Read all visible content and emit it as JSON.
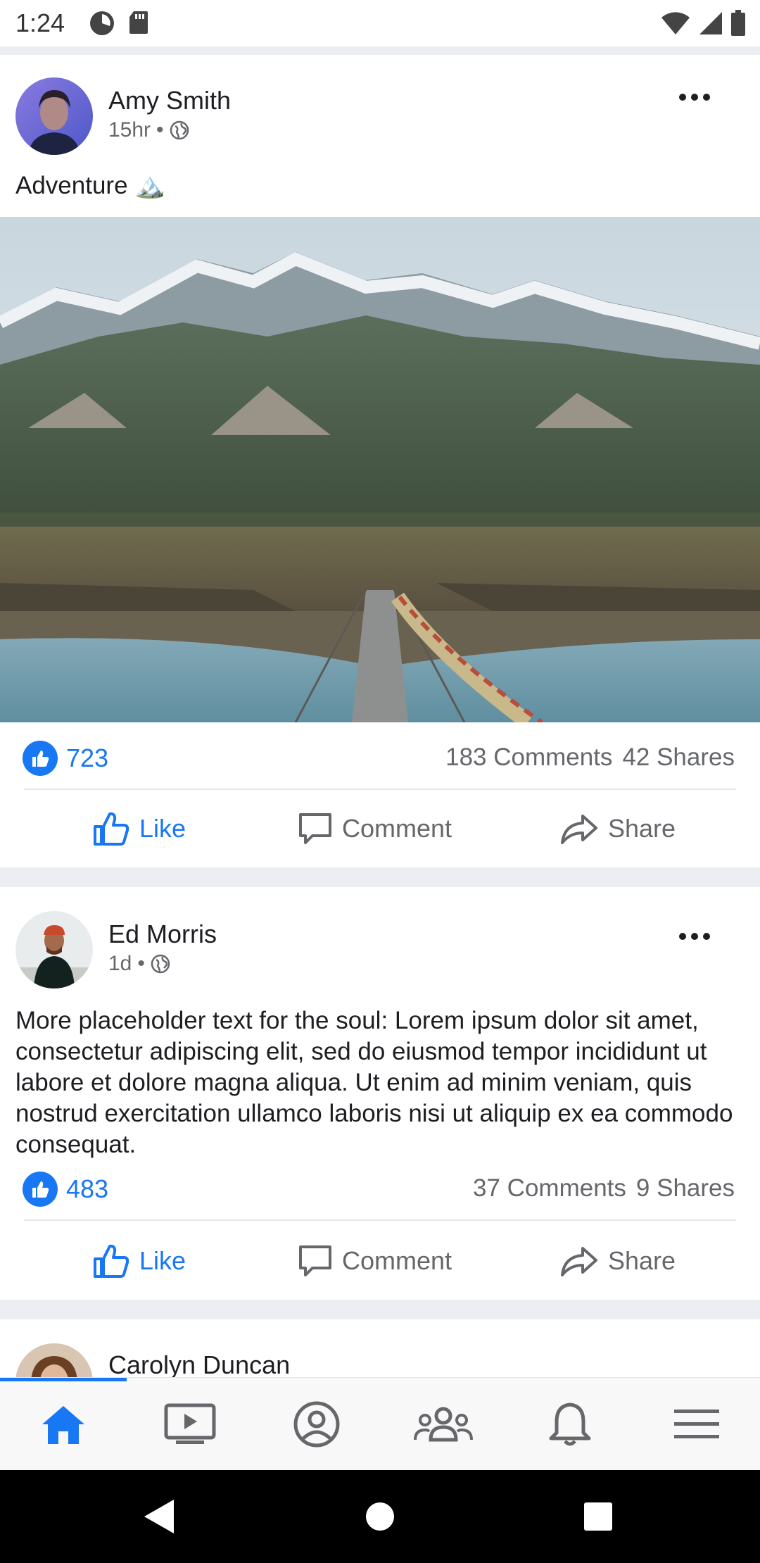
{
  "status_bar": {
    "time": "1:24",
    "left_icons": [
      "pie-circle-icon",
      "sd-card-icon"
    ],
    "right_icons": [
      "wifi-icon",
      "signal-icon",
      "battery-icon"
    ]
  },
  "posts": [
    {
      "author": "Amy Smith",
      "time": "15hr",
      "separator": "•",
      "privacy_icon": "globe-icon",
      "text": "Adventure 🏔️",
      "image_icon": "mountain-bridge-photo",
      "likes": "723",
      "comments": "183 Comments",
      "shares": "42 Shares",
      "actions": {
        "like": "Like",
        "comment": "Comment",
        "share": "Share"
      }
    },
    {
      "author": "Ed Morris",
      "time": "1d",
      "separator": "•",
      "privacy_icon": "globe-icon",
      "text": "More placeholder text for the soul: Lorem ipsum dolor sit amet, consectetur adipiscing elit, sed do eiusmod tempor incididunt ut labore et dolore magna aliqua. Ut enim ad minim veniam, quis nostrud exercitation ullamco laboris nisi ut aliquip ex ea commodo consequat.",
      "likes": "483",
      "comments": "37 Comments",
      "shares": "9 Shares",
      "actions": {
        "like": "Like",
        "comment": "Comment",
        "share": "Share"
      }
    },
    {
      "author": "Carolyn Duncan"
    }
  ],
  "bottom_nav": {
    "items": [
      "home-icon",
      "video-icon",
      "profile-icon",
      "groups-icon",
      "notifications-icon",
      "menu-icon"
    ],
    "active": "home-icon"
  },
  "system_nav": [
    "back-icon",
    "home-circle-icon",
    "recents-icon"
  ],
  "colors": {
    "accent": "#1877f2",
    "text": "#1c1e21",
    "secondary_text": "#65676b",
    "separator": "#eceef1"
  }
}
